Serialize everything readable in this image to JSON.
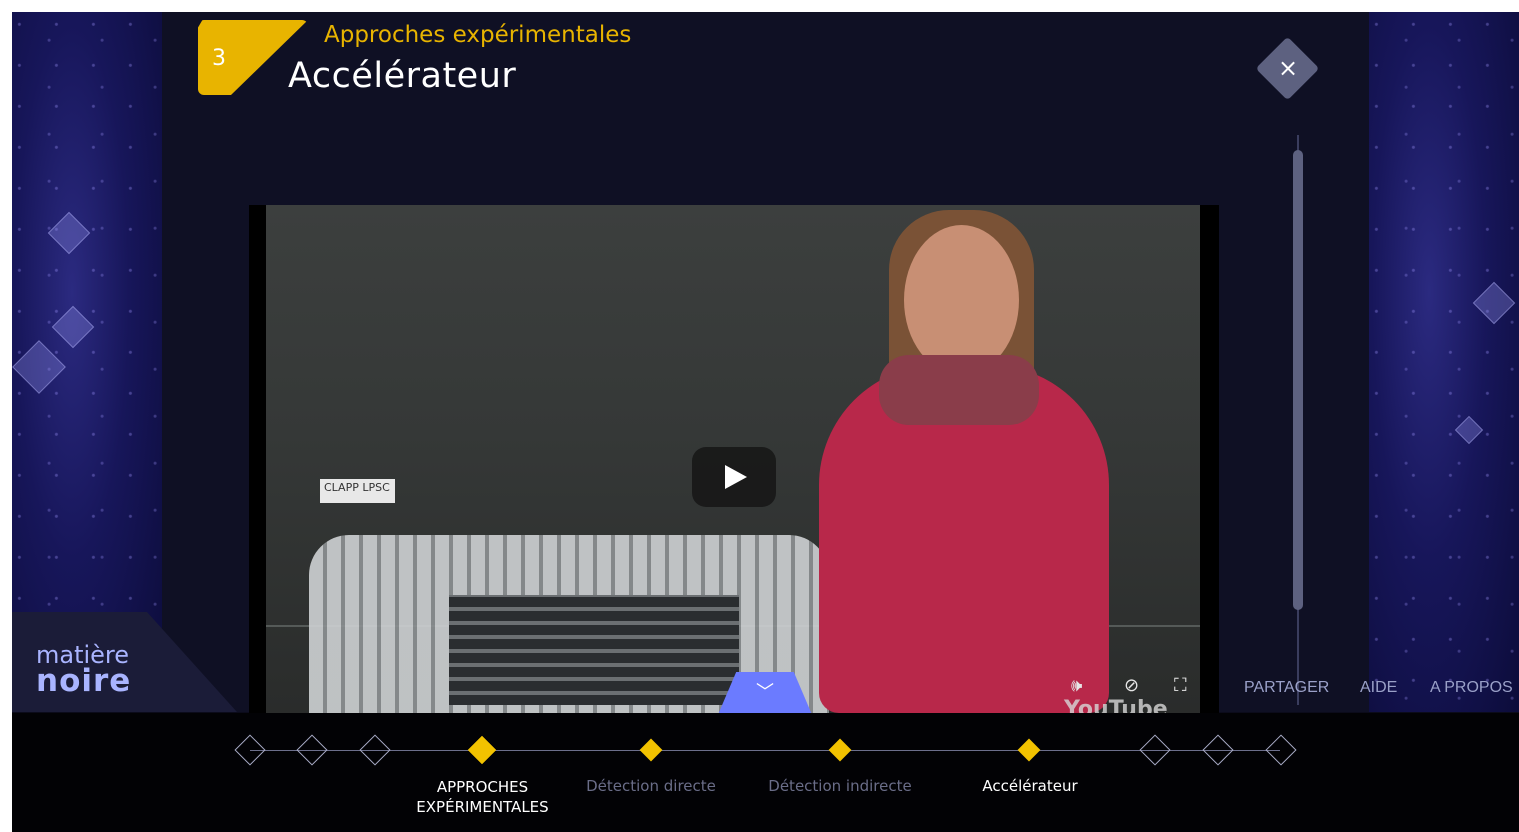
{
  "header": {
    "chapter_number": "3",
    "subtitle": "Approches expérimentales",
    "title": "Accélérateur"
  },
  "close_label": "×",
  "video": {
    "lab_sign": "CLAPP LPSC",
    "youtube_label": "YouTube",
    "controls": {
      "volume": "🕪",
      "captions": "⊘",
      "fullscreen": "⛶"
    }
  },
  "logo": {
    "line1": "matière",
    "line2": "noire"
  },
  "nav_links": [
    "PARTAGER",
    "AIDE",
    "A PROPOS"
  ],
  "timeline": {
    "labels": [
      {
        "text": "APPROCHES\nEXPÉRIMENTALES"
      },
      {
        "text": "Détection directe"
      },
      {
        "text": "Détection indirecte"
      },
      {
        "text": "Accélérateur"
      }
    ]
  },
  "colors": {
    "accent_gold": "#e8b400",
    "panel_bg": "#0f1024",
    "expand_tab": "#6b7bff",
    "logo_text": "#a9b4ff"
  }
}
